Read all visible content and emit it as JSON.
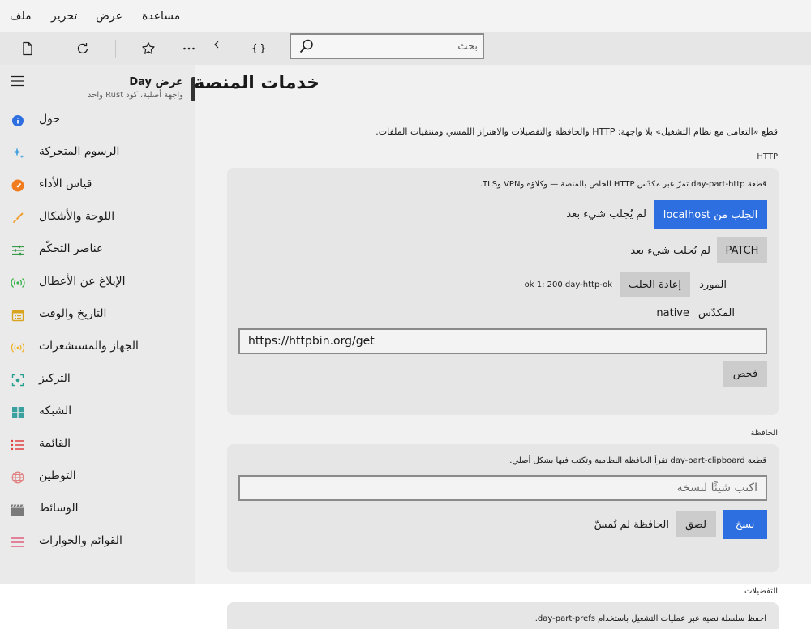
{
  "menu": {
    "file": "ملف",
    "edit": "تحرير",
    "view": "عرض",
    "help": "مساعدة"
  },
  "toolbar": {
    "icons": [
      "document-icon",
      "refresh-icon",
      "star-icon",
      "more-icon",
      "chevron-left-icon",
      "braces-icon"
    ],
    "search_placeholder": "بحث"
  },
  "sidebar": {
    "app_title": "عرض Day",
    "app_subtitle": "واجهة أصلية، كود Rust واحد",
    "items": [
      {
        "label": "حول",
        "icon": "info-icon",
        "color": "#2d6ee0"
      },
      {
        "label": "الرسوم المتحركة",
        "icon": "sparkle-icon",
        "color": "#4aa3df"
      },
      {
        "label": "قياس الأداء",
        "icon": "gauge-icon",
        "color": "#f07c1e"
      },
      {
        "label": "اللوحة والأشكال",
        "icon": "brush-icon",
        "color": "#f0a030"
      },
      {
        "label": "عناصر التحكّم",
        "icon": "sliders-icon",
        "color": "#3a9a4a"
      },
      {
        "label": "الإبلاغ عن الأعطال",
        "icon": "broadcast-icon",
        "color": "#3bb34a"
      },
      {
        "label": "التاريخ والوقت",
        "icon": "calendar-icon",
        "color": "#d9a520"
      },
      {
        "label": "الجهاز والمستشعرات",
        "icon": "sensor-icon",
        "color": "#f0b020"
      },
      {
        "label": "التركيز",
        "icon": "focus-icon",
        "color": "#2aa090"
      },
      {
        "label": "الشبكة",
        "icon": "grid-icon",
        "color": "#3aa0a0"
      },
      {
        "label": "القائمة",
        "icon": "list-icon",
        "color": "#e04040"
      },
      {
        "label": "التوطين",
        "icon": "globe-icon",
        "color": "#e08080"
      },
      {
        "label": "الوسائط",
        "icon": "clapper-icon",
        "color": "#7a7a7a"
      },
      {
        "label": "القوائم والحوارات",
        "icon": "menu-lines-icon",
        "color": "#e06080"
      }
    ]
  },
  "main": {
    "title": "خدمات المنصة",
    "description": "قطع «التعامل مع نظام التشغيل» بلا واجهة: HTTP والحافظة والتفضيلات والاهتزاز اللمسي ومنتقيات الملفات.",
    "http": {
      "section_label": "HTTP",
      "description": "قطعة day-part-http تمرّ عبر مكدّس HTTP الخاص بالمنصة — وكلاؤه وVPN وTLS.",
      "fetch_localhost_button": "الجلب من localhost",
      "fetch_localhost_status": "لم يُجلب شيء بعد",
      "patch_button": "PATCH",
      "patch_status": "لم يُجلب شيء بعد",
      "resource_label": "المورد",
      "refetch_button": "إعادة الجلب",
      "resource_value": "ok 1: 200 day-http-ok",
      "stack_label": "المكدّس",
      "stack_value": "native",
      "url_value": "https://httpbin.org/get",
      "check_button": "فحص"
    },
    "clipboard": {
      "section_label": "الحافظة",
      "description": "قطعة day-part-clipboard تقرأ الحافظة النظامية وتكتب فيها بشكل أصلي.",
      "input_placeholder": "اكتب شيئًا لنسخه",
      "copy_button": "نسخ",
      "paste_button": "لصق",
      "status": "الحافظة لم تُمسّ"
    },
    "prefs": {
      "section_label": "التفضيلات",
      "description": "احفظ سلسلة نصية عبر عمليات التشغيل باستخدام day-part-prefs."
    }
  },
  "colors": {
    "accent": "#2d6ee0",
    "sidebar_bg": "#eaeaea",
    "main_bg": "#f1f1f1",
    "card_bg": "#e6e6e6"
  }
}
